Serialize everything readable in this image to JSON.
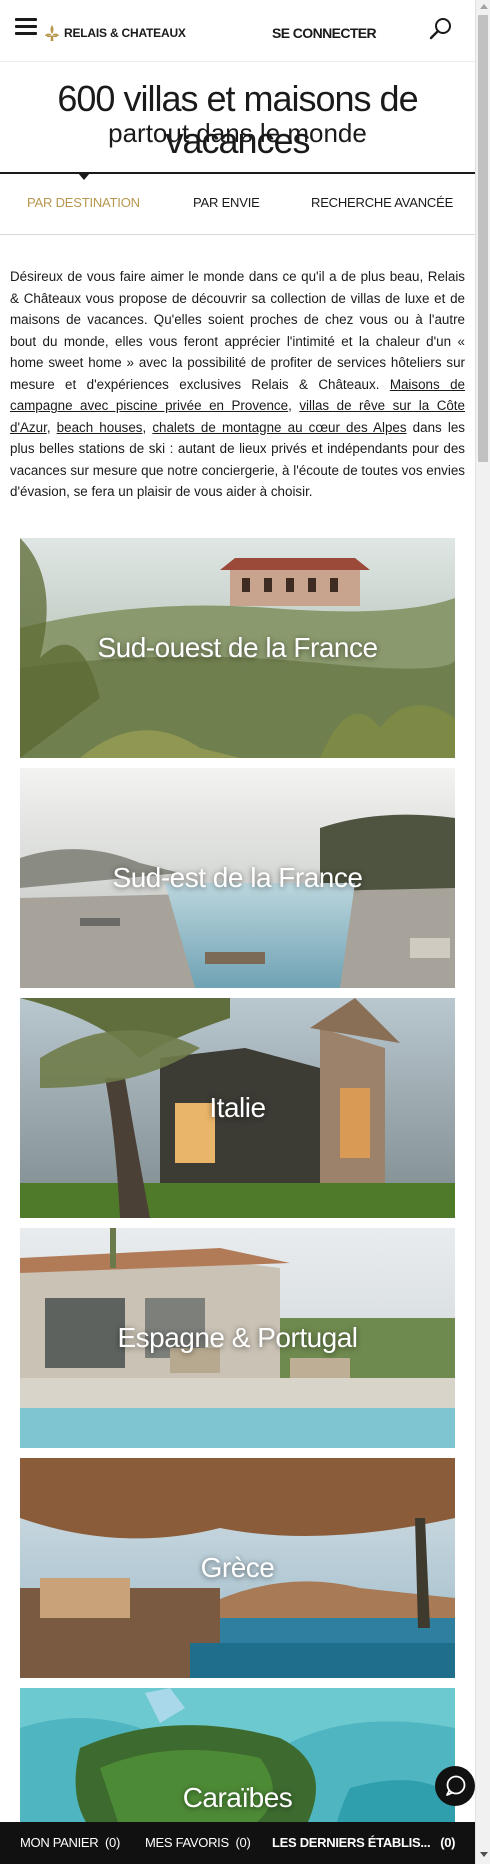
{
  "header": {
    "brand": "RELAIS & CHATEAUX",
    "login_label": "SE CONNECTER",
    "icons": [
      "menu-icon",
      "fleur-de-lis-icon",
      "search-icon"
    ]
  },
  "hero": {
    "title": "600 villas et maisons de vacances",
    "subtitle": "partout dans le monde"
  },
  "tabs": [
    {
      "label": "PAR DESTINATION",
      "active": true
    },
    {
      "label": "PAR ENVIE",
      "active": false
    },
    {
      "label": "RECHERCHE AVANCÉE",
      "active": false
    }
  ],
  "intro": {
    "text_1": "Désireux de vous faire aimer le monde dans ce qu'il a de plus beau, Relais & Châteaux vous propose de découvrir sa collection de villas de luxe et de maisons de vacances. Qu'elles soient proches de chez vous ou à l'autre bout du monde, elles vous feront apprécier l'intimité et la chaleur d'un « home sweet home » avec la possibilité de profiter de services hôteliers sur mesure et d'expériences exclusives Relais & Châteaux. ",
    "link_1": "Maisons de campagne avec piscine privée en Provence",
    "sep_1": ", ",
    "link_2": "villas de rêve sur la Côte d'Azur",
    "sep_2": ", ",
    "link_3": "beach houses",
    "sep_3": ", ",
    "link_4": "chalets de montagne au cœur des Alpes",
    "text_2": " dans les plus belles stations de ski : autant de lieux privés et indépendants pour des vacances sur mesure que notre conciergerie, à l'écoute de toutes vos envies d'évasion, se fera un plaisir de vous aider à choisir."
  },
  "destinations": [
    {
      "label": "Sud-ouest de la France"
    },
    {
      "label": "Sud-est de la France"
    },
    {
      "label": "Italie"
    },
    {
      "label": "Espagne & Portugal"
    },
    {
      "label": "Grèce"
    },
    {
      "label": "Caraïbes"
    }
  ],
  "bottom_bar": {
    "cart": "MON PANIER  (0)",
    "favorites": "MES FAVORIS  (0)",
    "recent": "LES DERNIERS ÉTABLIS...   (0)"
  },
  "colors": {
    "accent_gold": "#b9974f",
    "text": "#1a1a1a",
    "bottom_bar_bg": "#111111"
  }
}
